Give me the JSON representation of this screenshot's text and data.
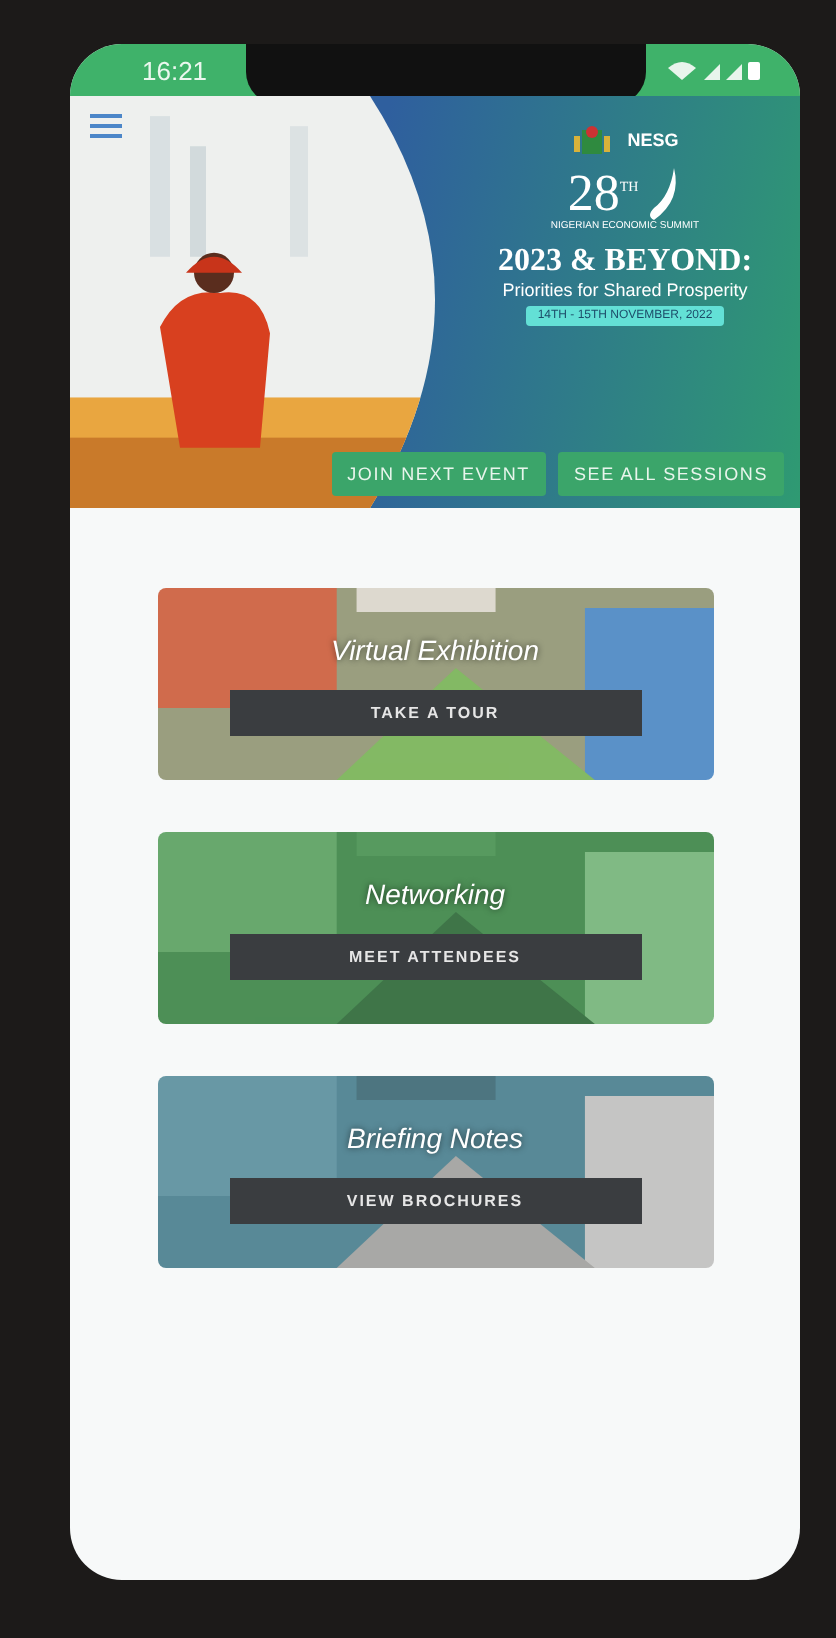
{
  "status_bar": {
    "time": "16:21"
  },
  "banner": {
    "logo_text": "NESG",
    "edition": "28",
    "edition_suffix": "TH",
    "summit_name": "NIGERIAN ECONOMIC SUMMIT",
    "title": "2023 & BEYOND:",
    "subtitle": "Priorities for Shared Prosperity",
    "dates": "14TH - 15TH NOVEMBER, 2022",
    "buttons": [
      "JOIN NEXT EVENT",
      "SEE ALL SESSIONS"
    ]
  },
  "cards": [
    {
      "kind": "exhibition",
      "title": "Virtual Exhibition",
      "button": "TAKE A TOUR"
    },
    {
      "kind": "networking",
      "title": "Networking",
      "button": "MEET ATTENDEES"
    },
    {
      "kind": "notes",
      "title": "Briefing Notes",
      "button": "VIEW BROCHURES"
    }
  ]
}
